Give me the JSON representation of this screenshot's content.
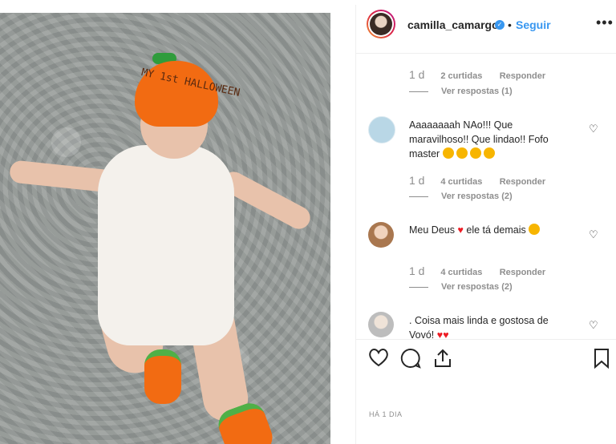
{
  "header": {
    "username": "camilla_camargo",
    "verified_mark": "✓",
    "separator": "•",
    "follow_label": "Seguir",
    "more_label": "•••"
  },
  "comments": [
    {
      "text": "",
      "time": "1 d",
      "likes": "2 curtidas",
      "reply_label": "Responder",
      "view_replies": "Ver respostas (1)"
    },
    {
      "text": "Aaaaaaaah NAo!!! Que maravilhoso!! Que lindao!! Fofo master",
      "time": "1 d",
      "likes": "4 curtidas",
      "reply_label": "Responder",
      "view_replies": "Ver respostas (2)",
      "avatar_color": "#b9d7e6"
    },
    {
      "text": "Meu Deus",
      "text_after": "ele tá demais",
      "time": "1 d",
      "likes": "4 curtidas",
      "reply_label": "Responder",
      "view_replies": "Ver respostas (2)",
      "avatar_color": "#d8b49a"
    },
    {
      "text": ". Coisa mais linda e gostosa de Vovó!",
      "avatar_color": "#c9c9c9"
    }
  ],
  "photo": {
    "hat_text": "MY 1st HALLOWEEN"
  },
  "actions": {
    "like_icon": "heart-icon",
    "comment_icon": "comment-icon",
    "share_icon": "share-icon",
    "save_icon": "bookmark-icon"
  },
  "time_ago": "HÁ 1 DIA",
  "colors": {
    "link_blue": "#3897f0",
    "muted": "#8e8e8e",
    "pumpkin": "#f26b12"
  }
}
